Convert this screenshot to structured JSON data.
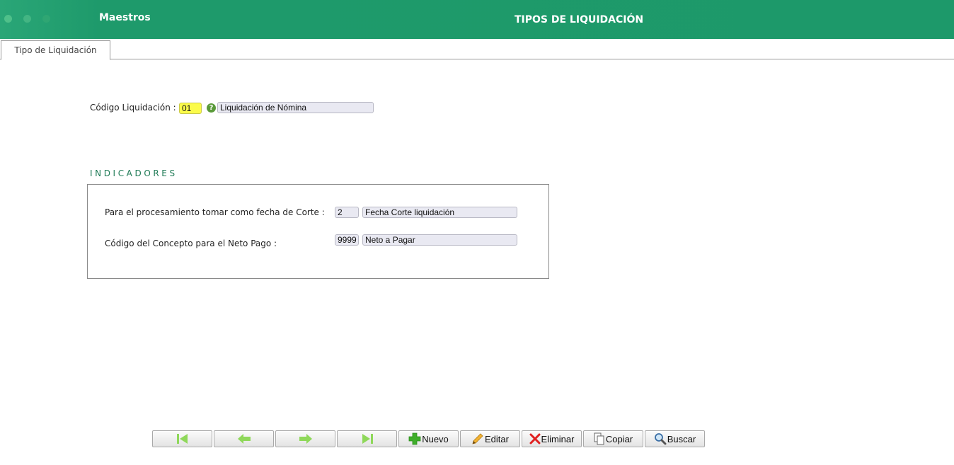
{
  "header": {
    "brand": "Maestros",
    "title": "TIPOS DE LIQUIDACIÓN"
  },
  "tabs": [
    {
      "label": "Tipo de Liquidación",
      "active": true
    }
  ],
  "liquidacion": {
    "label": "Código Liquidación :",
    "code": "01",
    "description": "Liquidación de Nómina"
  },
  "indicadores": {
    "title": "INDICADORES",
    "rows": [
      {
        "label": "Para el procesamiento tomar como fecha de Corte :",
        "code": "2",
        "description": "Fecha Corte liquidación"
      },
      {
        "label": "Código del Concepto para el Neto Pago :",
        "code": "9999",
        "description": "Neto a Pagar"
      }
    ]
  },
  "toolbar": {
    "nuevo": "Nuevo",
    "editar": "Editar",
    "eliminar": "Eliminar",
    "copiar": "Copiar",
    "buscar": "Buscar"
  },
  "colors": {
    "header_green": "#1e9a6b",
    "nav_arrow_green": "#8fd85a",
    "highlight_yellow": "#fbfb4a",
    "section_title": "#1e7a55"
  },
  "icons": {
    "first": "first-record-icon",
    "prev": "previous-record-icon",
    "next": "next-record-icon",
    "last": "last-record-icon",
    "nuevo": "plus-icon",
    "editar": "pencil-icon",
    "eliminar": "x-icon",
    "copiar": "copy-icon",
    "buscar": "magnifier-icon",
    "help": "help-icon"
  }
}
